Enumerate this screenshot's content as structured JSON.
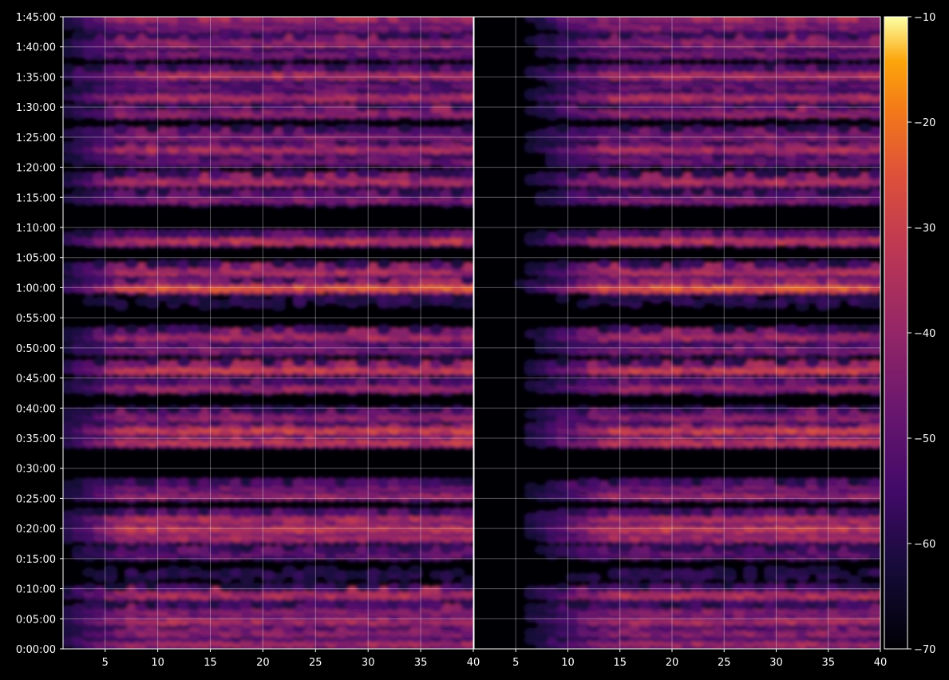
{
  "chart_data": {
    "type": "heatmap",
    "background": "#000000",
    "colormap": "inferno",
    "grid": true,
    "panels": 2,
    "xlim": [
      1,
      40
    ],
    "ylim_seconds": [
      0,
      6300
    ],
    "x_ticks": [
      5,
      10,
      15,
      20,
      25,
      30,
      35,
      40
    ],
    "y_ticks": [
      "0:00:00",
      "0:05:00",
      "0:10:00",
      "0:15:00",
      "0:20:00",
      "0:25:00",
      "0:30:00",
      "0:35:00",
      "0:40:00",
      "0:45:00",
      "0:50:00",
      "0:55:00",
      "1:00:00",
      "1:05:00",
      "1:10:00",
      "1:15:00",
      "1:20:00",
      "1:25:00",
      "1:30:00",
      "1:35:00",
      "1:40:00",
      "1:45:00"
    ],
    "colorbar": {
      "ticks": [
        -10,
        -20,
        -30,
        -40,
        -50,
        -60,
        -70
      ],
      "range": [
        -70,
        -10
      ]
    },
    "intensity_bands": [
      {
        "t": 70,
        "level": -38
      },
      {
        "t": 180,
        "level": -42
      },
      {
        "t": 300,
        "level": -36
      },
      {
        "t": 390,
        "level": -44
      },
      {
        "t": 560,
        "level": -36
      },
      {
        "t": 740,
        "level": -62
      },
      {
        "t": 960,
        "level": -50
      },
      {
        "t": 1130,
        "level": -38
      },
      {
        "t": 1220,
        "level": -31
      },
      {
        "t": 1315,
        "level": -36
      },
      {
        "t": 1550,
        "level": -40
      },
      {
        "t": 1620,
        "level": -46
      },
      {
        "t": 2080,
        "level": -33
      },
      {
        "t": 2200,
        "level": -30
      },
      {
        "t": 2330,
        "level": -42
      },
      {
        "t": 2620,
        "level": -40
      },
      {
        "t": 2800,
        "level": -30
      },
      {
        "t": 3000,
        "level": -44
      },
      {
        "t": 3130,
        "level": -38
      },
      {
        "t": 3470,
        "level": -62
      },
      {
        "t": 3620,
        "level": -24
      },
      {
        "t": 3780,
        "level": -36
      },
      {
        "t": 4090,
        "level": -34
      },
      {
        "t": 4500,
        "level": -44
      },
      {
        "t": 4680,
        "level": -36
      },
      {
        "t": 4880,
        "level": -48
      },
      {
        "t": 5000,
        "level": -36
      },
      {
        "t": 5130,
        "level": -44
      },
      {
        "t": 5360,
        "level": -42
      },
      {
        "t": 5520,
        "level": -36
      },
      {
        "t": 5630,
        "level": -50
      },
      {
        "t": 5740,
        "level": -36
      },
      {
        "t": 5950,
        "level": -46
      },
      {
        "t": 6060,
        "level": -42
      },
      {
        "t": 6220,
        "level": -44
      },
      {
        "t": 6300,
        "level": -38
      }
    ]
  }
}
